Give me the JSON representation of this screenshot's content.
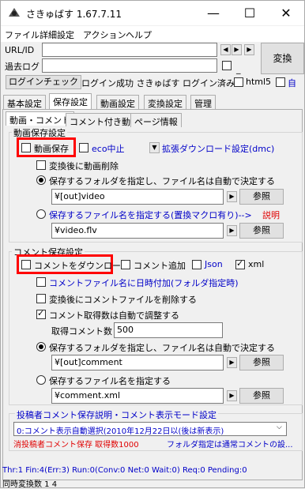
{
  "window": {
    "title": "さきゅばす 1.67.7.11",
    "minimize": "—",
    "maximize": "☐",
    "close": "✕"
  },
  "menu": [
    "ファイル",
    "詳細設定",
    "アクション",
    "ヘルプ"
  ],
  "url_label": "URL/ID",
  "log_label": "過去ログ",
  "convert_button": "変換",
  "login_check_button": "ログインチェック",
  "login_status": "ログイン成功 さきゅばす ログイン済み",
  "html5_label": "html5",
  "auto_label": "自",
  "tabs_main": [
    "基本設定",
    "保存設定",
    "動画設定",
    "変換設定",
    "管理"
  ],
  "tabs_sub": [
    "動画・コメント",
    "コメント付き動画",
    "ページ情報"
  ],
  "video_group": {
    "title": "動画保存設定",
    "save_video": "動画保存",
    "eco": "eco中止",
    "extended_dl": "拡張ダウンロード設定(dmc)",
    "delete_after": "変換後に動画削除",
    "save_folder_radio": "保存するフォルダを指定し、ファイル名は自動で決定する",
    "folder_value": "¥[out]video",
    "browse": "参照",
    "save_file_radio": "保存するファイル名を指定する(置換マクロ有り)-->",
    "explain": "説明",
    "file_value": "¥video.flv"
  },
  "comment_group": {
    "title": "コメント保存設定",
    "download": "コメントをダウンロード",
    "add": "コメント追加",
    "json": "Json",
    "xml": "xml",
    "date_in_name": "コメントファイル名に日時付加(フォルダ指定時)",
    "delete_after": "変換後にコメントファイルを削除する",
    "auto_count": "コメント取得数は自動で調整する",
    "count_label": "取得コメント数",
    "count_value": "500",
    "save_folder_radio": "保存するフォルダを指定し、ファイル名は自動で決定する",
    "folder_value": "¥[out]comment",
    "browse": "参照",
    "save_file_radio": "保存するファイル名を指定する",
    "file_value": "¥comment.xml"
  },
  "poster_group": {
    "title": "投稿者コメント保存説明・コメント表示モード設定",
    "select_value": "0:コメント表示自動選択(2010年12月22日以(後は新表示)",
    "note1": "消投稿者コメント保存 取得数1000",
    "note2": "フォルダ指定は通常コメントの設..."
  },
  "status": {
    "line1": "Thr:1 Fin:4(Err:3) Run:0(Conv:0 Net:0 Wait:0) Req:0 Pending:0",
    "line2": "同時変換数 1 4"
  }
}
